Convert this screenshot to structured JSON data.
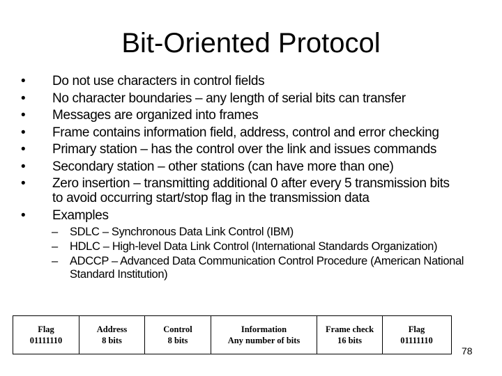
{
  "slide": {
    "title": "Bit-Oriented Protocol",
    "bullet_glyph": "•",
    "sub_bullet_glyph": "–",
    "bullets": [
      {
        "text": "Do not use characters in control fields"
      },
      {
        "text": "No character boundaries – any length of serial bits can transfer"
      },
      {
        "text": "Messages are organized into frames"
      },
      {
        "text": "Frame contains information field, address, control and error checking"
      },
      {
        "text": "Primary station – has the control over the link and issues commands"
      },
      {
        "text": "Secondary station – other stations (can have more than one)"
      },
      {
        "text": "Zero insertion – transmitting additional 0 after every 5 transmission bits to avoid occurring start/stop flag in the transmission data"
      },
      {
        "text": "Examples"
      }
    ],
    "sub_bullets": [
      {
        "text": "SDLC – Synchronous Data Link Control (IBM)"
      },
      {
        "text": "HDLC – High-level Data Link Control (International Standards Organization)"
      },
      {
        "text": "ADCCP – Advanced Data Communication Control Procedure (American National Standard Institution)"
      }
    ],
    "frame_fields": [
      {
        "name": "Flag",
        "value": "01111110"
      },
      {
        "name": "Address",
        "value": "8 bits"
      },
      {
        "name": "Control",
        "value": "8 bits"
      },
      {
        "name": "Information",
        "value": "Any number of bits"
      },
      {
        "name": "Frame check",
        "value": "16 bits"
      },
      {
        "name": "Flag",
        "value": "01111110"
      }
    ],
    "page_number": "78"
  }
}
